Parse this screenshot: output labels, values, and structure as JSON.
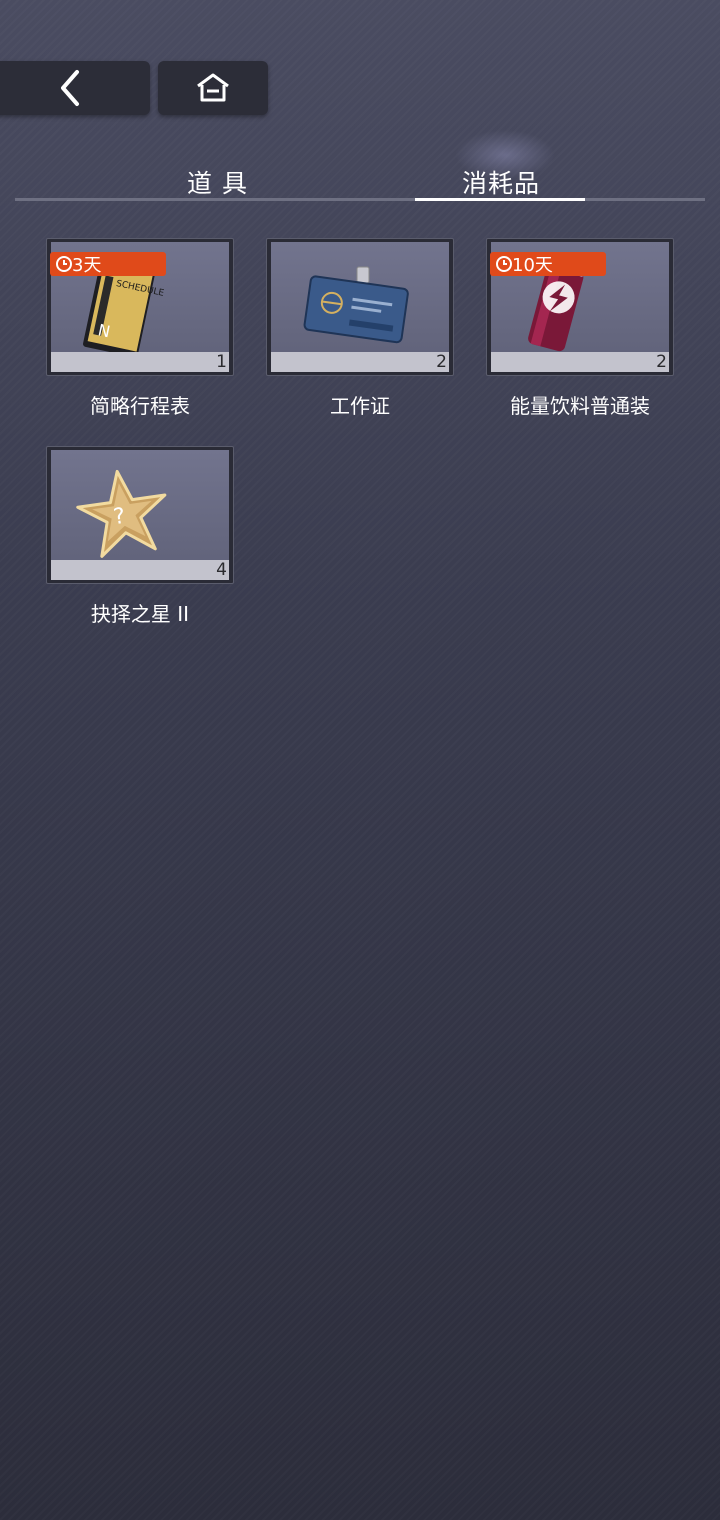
{
  "tabs": [
    {
      "label": "道具",
      "active": false
    },
    {
      "label": "消耗品",
      "active": true
    }
  ],
  "items": [
    {
      "name": "简略行程表",
      "count": "1",
      "timer": "3天",
      "icon": "schedule-card-icon"
    },
    {
      "name": "工作证",
      "count": "2",
      "timer": "",
      "icon": "id-badge-icon"
    },
    {
      "name": "能量饮料普通装",
      "count": "2",
      "timer": "10天",
      "icon": "energy-drink-icon"
    },
    {
      "name": "抉择之星 II",
      "count": "4",
      "timer": "",
      "icon": "gold-star-icon"
    }
  ],
  "art": {
    "schedule_word": "SCHEDULE",
    "schedule_letter": "N"
  },
  "colors": {
    "timer_bg": "#e04a1a",
    "active_tab_line": "#ffffff",
    "tab_line": "#6e7082"
  }
}
